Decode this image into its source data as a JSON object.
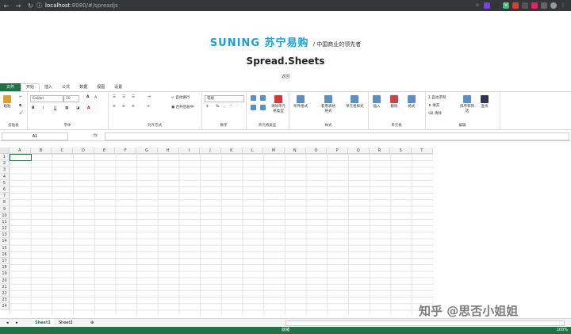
{
  "browser": {
    "host": "localhost",
    "path": ":8080/#/spreadjs"
  },
  "logo": {
    "brand": "SUNING 苏宁易购",
    "slogan": "/ 中国商业的领先者"
  },
  "title": "Spread.Sheets",
  "back": "返回",
  "tabs": [
    "文件",
    "开始",
    "插入",
    "公式",
    "数据",
    "视图",
    "设置"
  ],
  "ribbon": {
    "clipboard": {
      "paste": "粘贴",
      "name": "剪贴板"
    },
    "font": {
      "font_name": "Calibri",
      "font_size": "10",
      "bold": "B",
      "italic": "I",
      "underline": "U",
      "grow": "A",
      "shrink": "A",
      "color_a": "A",
      "name": "字体"
    },
    "align": {
      "wrap": "自动换行",
      "merge": "合并后居中",
      "name": "对齐方式"
    },
    "number": {
      "format": "常规",
      "percent": "%",
      "comma": ",",
      "name": "数字"
    },
    "celltype": {
      "clear": "清除单元格类型",
      "name": "单元格类型"
    },
    "style": {
      "cond": "条件格式",
      "table": "套用表格格式",
      "cellstyle": "单元格样式",
      "name": "样式"
    },
    "cells": {
      "insert": "插入",
      "delete": "删除",
      "format": "格式",
      "name": "单元格"
    },
    "edit": {
      "autosum": "自动求和",
      "fill": "填充",
      "clear": "清除",
      "sort": "排序和筛选",
      "find": "查找",
      "name": "编辑"
    }
  },
  "formula_bar": {
    "namebox": "A1",
    "fx": "fx"
  },
  "columns": [
    "A",
    "B",
    "C",
    "D",
    "E",
    "F",
    "G",
    "H",
    "I",
    "J",
    "K",
    "L",
    "M",
    "N",
    "O",
    "P",
    "Q",
    "R",
    "S",
    "T"
  ],
  "rows": [
    "1",
    "2",
    "3",
    "4",
    "5",
    "6",
    "7",
    "8",
    "9",
    "10",
    "11",
    "12",
    "13",
    "14",
    "15",
    "16",
    "17",
    "18",
    "19",
    "20",
    "21",
    "22",
    "23",
    "24"
  ],
  "sheets": [
    "Sheet1",
    "Sheet2"
  ],
  "status": {
    "ready": "就绪",
    "zoom": "100%"
  },
  "watermark": "知乎 @思否小姐姐"
}
